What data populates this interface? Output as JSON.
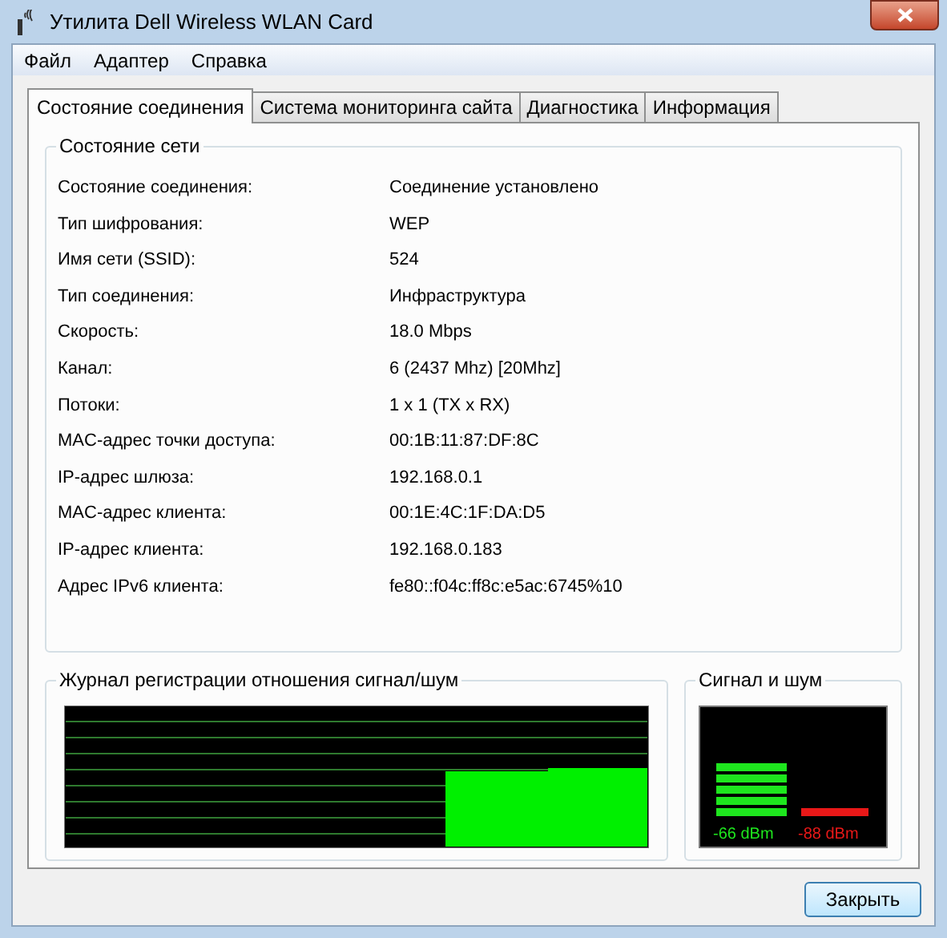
{
  "window": {
    "title": "Утилита Dell Wireless WLAN Card"
  },
  "menu": [
    "Файл",
    "Адаптер",
    "Справка"
  ],
  "tabs": [
    {
      "label": "Состояние соединения",
      "selected": true
    },
    {
      "label": "Система мониторинга сайта",
      "selected": false
    },
    {
      "label": "Диагностика",
      "selected": false
    },
    {
      "label": "Информация",
      "selected": false
    }
  ],
  "network_status": {
    "title": "Состояние сети",
    "rows": [
      {
        "label": "Состояние соединения:",
        "value": "Соединение установлено"
      },
      {
        "label": "Тип шифрования:",
        "value": "WEP"
      },
      {
        "label": "Имя сети (SSID):",
        "value": "524"
      },
      {
        "label": "Тип соединения:",
        "value": "Инфраструктура"
      },
      {
        "label": "Скорость:",
        "value": "18.0 Mbps"
      },
      {
        "label": "Канал:",
        "value": "6 (2437 Mhz) [20Mhz]"
      },
      {
        "label": "Потоки:",
        "value": "1 x 1 (TX x RX)"
      },
      {
        "label": "MAC-адрес точки доступа:",
        "value": "00:1B:11:87:DF:8C"
      },
      {
        "label": "IP-адрес шлюза:",
        "value": "192.168.0.1"
      },
      {
        "label": "MAC-адрес клиента:",
        "value": "00:1E:4C:1F:DA:D5"
      },
      {
        "label": "IP-адрес клиента:",
        "value": "192.168.0.183"
      },
      {
        "label": "Адрес IPv6 клиента:",
        "value": "fe80::f04c:ff8c:e5ac:6745%10"
      }
    ]
  },
  "snr_log": {
    "title": "Журнал регистрации отношения сигнал/шум"
  },
  "signal_noise": {
    "title": "Сигнал и шум",
    "signal": "-66 dBm",
    "noise": "-88 dBm"
  },
  "buttons": [
    "Закрыть"
  ]
}
